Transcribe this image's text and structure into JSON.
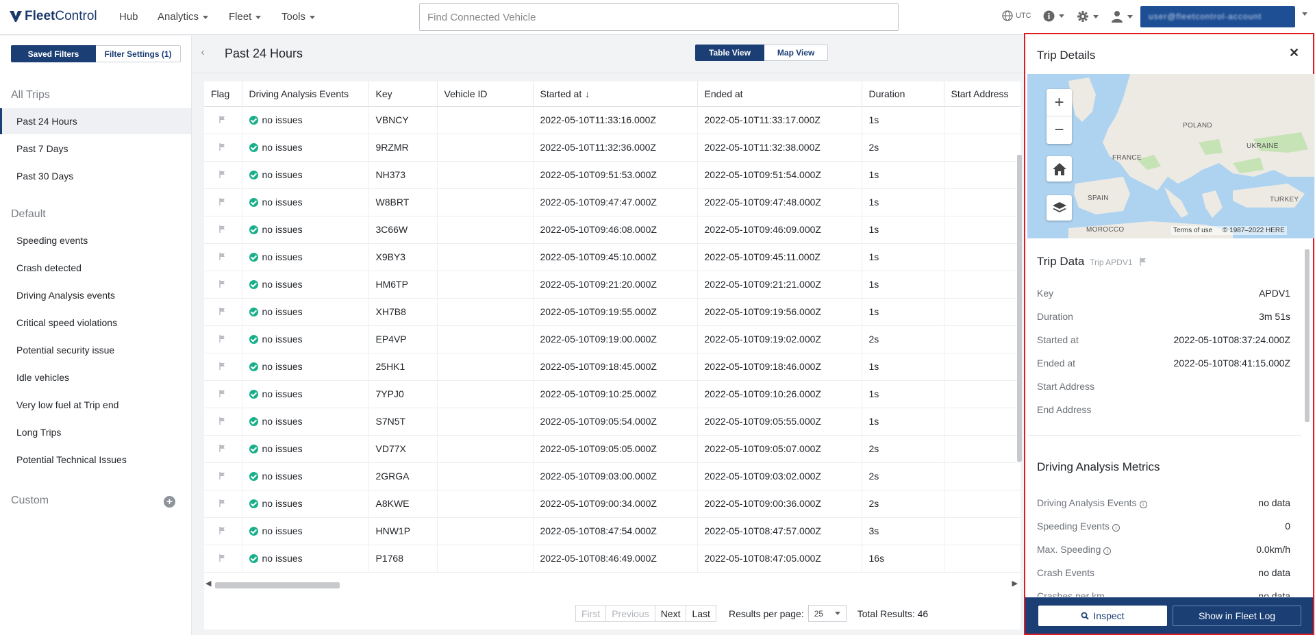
{
  "nav": {
    "logo": {
      "prefix": "Fleet",
      "suffix": "Control"
    },
    "items": [
      {
        "label": "Hub",
        "dropdown": false
      },
      {
        "label": "Analytics",
        "dropdown": true
      },
      {
        "label": "Fleet",
        "dropdown": true
      },
      {
        "label": "Tools",
        "dropdown": true
      }
    ],
    "search_placeholder": "Find Connected Vehicle",
    "timezone": "UTC",
    "user_label": "user@fleetcontrol-account"
  },
  "sidebar": {
    "saved_filters": "Saved Filters",
    "filter_settings": "Filter Settings (1)",
    "sections": [
      {
        "title": "All Trips",
        "items": [
          "Past 24 Hours",
          "Past 7 Days",
          "Past 30 Days"
        ]
      },
      {
        "title": "Default",
        "items": [
          "Speeding events",
          "Crash detected",
          "Driving Analysis events",
          "Critical speed violations",
          "Potential security issue",
          "Idle vehicles",
          "Very low fuel at Trip end",
          "Long Trips",
          "Potential Technical Issues"
        ]
      },
      {
        "title": "Custom",
        "items": []
      }
    ],
    "active_item": "Past 24 Hours"
  },
  "main": {
    "title": "Past 24 Hours",
    "view_toggle": {
      "table": "Table View",
      "map": "Map View",
      "selected": "Table View"
    }
  },
  "table": {
    "columns": [
      "Flag",
      "Driving Analysis Events",
      "Key",
      "Vehicle ID",
      "Started at",
      "Ended at",
      "Duration",
      "Start Address"
    ],
    "sorted_column": "Started at",
    "sort_direction": "descending",
    "rows": [
      {
        "events": "no issues",
        "key": "VBNCY",
        "vehicle_id": "",
        "started": "2022-05-10T11:33:16.000Z",
        "ended": "2022-05-10T11:33:17.000Z",
        "duration": "1s",
        "start_address": ""
      },
      {
        "events": "no issues",
        "key": "9RZMR",
        "vehicle_id": "",
        "started": "2022-05-10T11:32:36.000Z",
        "ended": "2022-05-10T11:32:38.000Z",
        "duration": "2s",
        "start_address": ""
      },
      {
        "events": "no issues",
        "key": "NH373",
        "vehicle_id": "",
        "started": "2022-05-10T09:51:53.000Z",
        "ended": "2022-05-10T09:51:54.000Z",
        "duration": "1s",
        "start_address": ""
      },
      {
        "events": "no issues",
        "key": "W8BRT",
        "vehicle_id": "",
        "started": "2022-05-10T09:47:47.000Z",
        "ended": "2022-05-10T09:47:48.000Z",
        "duration": "1s",
        "start_address": ""
      },
      {
        "events": "no issues",
        "key": "3C66W",
        "vehicle_id": "",
        "started": "2022-05-10T09:46:08.000Z",
        "ended": "2022-05-10T09:46:09.000Z",
        "duration": "1s",
        "start_address": ""
      },
      {
        "events": "no issues",
        "key": "X9BY3",
        "vehicle_id": "",
        "started": "2022-05-10T09:45:10.000Z",
        "ended": "2022-05-10T09:45:11.000Z",
        "duration": "1s",
        "start_address": ""
      },
      {
        "events": "no issues",
        "key": "HM6TP",
        "vehicle_id": "",
        "started": "2022-05-10T09:21:20.000Z",
        "ended": "2022-05-10T09:21:21.000Z",
        "duration": "1s",
        "start_address": ""
      },
      {
        "events": "no issues",
        "key": "XH7B8",
        "vehicle_id": "",
        "started": "2022-05-10T09:19:55.000Z",
        "ended": "2022-05-10T09:19:56.000Z",
        "duration": "1s",
        "start_address": ""
      },
      {
        "events": "no issues",
        "key": "EP4VP",
        "vehicle_id": "",
        "started": "2022-05-10T09:19:00.000Z",
        "ended": "2022-05-10T09:19:02.000Z",
        "duration": "2s",
        "start_address": ""
      },
      {
        "events": "no issues",
        "key": "25HK1",
        "vehicle_id": "",
        "started": "2022-05-10T09:18:45.000Z",
        "ended": "2022-05-10T09:18:46.000Z",
        "duration": "1s",
        "start_address": ""
      },
      {
        "events": "no issues",
        "key": "7YPJ0",
        "vehicle_id": "",
        "started": "2022-05-10T09:10:25.000Z",
        "ended": "2022-05-10T09:10:26.000Z",
        "duration": "1s",
        "start_address": ""
      },
      {
        "events": "no issues",
        "key": "S7N5T",
        "vehicle_id": "",
        "started": "2022-05-10T09:05:54.000Z",
        "ended": "2022-05-10T09:05:55.000Z",
        "duration": "1s",
        "start_address": ""
      },
      {
        "events": "no issues",
        "key": "VD77X",
        "vehicle_id": "",
        "started": "2022-05-10T09:05:05.000Z",
        "ended": "2022-05-10T09:05:07.000Z",
        "duration": "2s",
        "start_address": ""
      },
      {
        "events": "no issues",
        "key": "2GRGA",
        "vehicle_id": "",
        "started": "2022-05-10T09:03:00.000Z",
        "ended": "2022-05-10T09:03:02.000Z",
        "duration": "2s",
        "start_address": ""
      },
      {
        "events": "no issues",
        "key": "A8KWE",
        "vehicle_id": "",
        "started": "2022-05-10T09:00:34.000Z",
        "ended": "2022-05-10T09:00:36.000Z",
        "duration": "2s",
        "start_address": ""
      },
      {
        "events": "no issues",
        "key": "HNW1P",
        "vehicle_id": "",
        "started": "2022-05-10T08:47:54.000Z",
        "ended": "2022-05-10T08:47:57.000Z",
        "duration": "3s",
        "start_address": ""
      },
      {
        "events": "no issues",
        "key": "P1768",
        "vehicle_id": "",
        "started": "2022-05-10T08:46:49.000Z",
        "ended": "2022-05-10T08:47:05.000Z",
        "duration": "16s",
        "start_address": ""
      }
    ]
  },
  "pagination": {
    "first": "First",
    "previous": "Previous",
    "next": "Next",
    "last": "Last",
    "results_per_page_label": "Results per page:",
    "results_per_page": "25",
    "total_results": "Total Results: 46"
  },
  "trip_panel": {
    "title": "Trip Details",
    "map": {
      "labels": [
        "POLAND",
        "UKRAINE",
        "FRANCE",
        "SPAIN",
        "TURKEY",
        "MOROCCO"
      ],
      "terms": "Terms of use",
      "copyright": "© 1987–2022 HERE"
    },
    "trip_data": {
      "heading": "Trip Data",
      "trip_id": "Trip APDV1",
      "fields": [
        {
          "key": "Key",
          "value": "APDV1"
        },
        {
          "key": "Duration",
          "value": "3m 51s"
        },
        {
          "key": "Started at",
          "value": "2022-05-10T08:37:24.000Z"
        },
        {
          "key": "Ended at",
          "value": "2022-05-10T08:41:15.000Z"
        },
        {
          "key": "Start Address",
          "value": ""
        },
        {
          "key": "End Address",
          "value": ""
        }
      ]
    },
    "metrics": {
      "heading": "Driving Analysis Metrics",
      "fields": [
        {
          "key": "Driving Analysis Events",
          "value": "no data",
          "info": true
        },
        {
          "key": "Speeding Events",
          "value": "0",
          "info": true
        },
        {
          "key": "Max. Speeding",
          "value": "0.0km/h",
          "info": true
        },
        {
          "key": "Crash Events",
          "value": "no data",
          "info": false
        },
        {
          "key": "Crashes per km",
          "value": "no data",
          "info": false
        }
      ]
    },
    "inspect": "Inspect",
    "fleet_log": "Show in Fleet Log"
  },
  "colors": {
    "primary": "#1b3f75",
    "ok_status": "#1aaf8b",
    "highlight_border": "#e01a22"
  }
}
